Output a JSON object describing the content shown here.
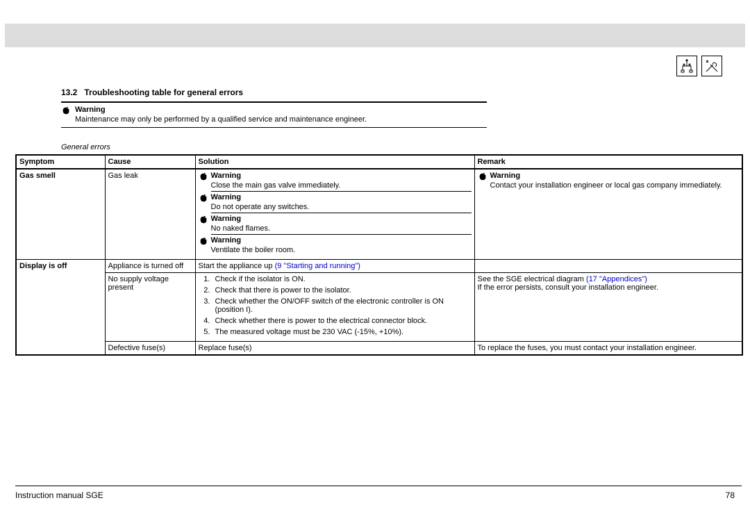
{
  "section": {
    "number": "13.2",
    "title": "Troubleshooting table for general errors"
  },
  "topWarning": {
    "label": "Warning",
    "text": "Maintenance may only be performed by a qualified service and maintenance engineer."
  },
  "caption": "General errors",
  "headers": {
    "symptom": "Symptom",
    "cause": "Cause",
    "solution": "Solution",
    "remark": "Remark"
  },
  "row1": {
    "symptom": "Gas smell",
    "cause": "Gas leak",
    "sol": {
      "w1l": "Warning",
      "w1t": "Close the main gas valve immediately.",
      "w2l": "Warning",
      "w2t": "Do not operate any switches.",
      "w3l": "Warning",
      "w3t": "No naked flames.",
      "w4l": "Warning",
      "w4t": "Ventilate the boiler room."
    },
    "rem": {
      "wl": "Warning",
      "wt": "Contact your installation engineer or local gas company immediately."
    }
  },
  "row2": {
    "symptom": "Display is off",
    "cause1": "Appliance is turned off",
    "sol1a": "Start the appliance up ",
    "sol1link": "(9 \"Starting and running\")",
    "cause2": "No supply voltage present",
    "checks": {
      "c1": "Check if the isolator is ON.",
      "c2": "Check that there is power to the isolator.",
      "c3": "Check whether the ON/OFF switch of the electronic controller is ON (position I).",
      "c4": "Check whether there is power to the electrical connector block.",
      "c5": "The measured voltage must be 230 VAC (-15%, +10%)."
    },
    "rem2a": "See the SGE electrical diagram ",
    "rem2link": "(17 \"Appendices\")",
    "rem2b": "If the error persists, consult your installation engineer.",
    "cause3": "Defective fuse(s)",
    "sol3": "Replace fuse(s)",
    "rem3": "To replace the fuses, you must contact your installation engineer."
  },
  "footer": {
    "left": "Instruction manual SGE",
    "right": "78"
  }
}
